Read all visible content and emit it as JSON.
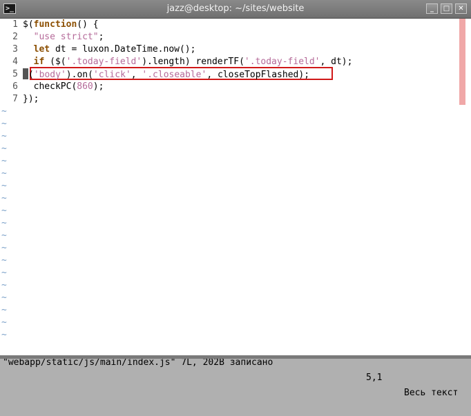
{
  "window": {
    "title": "jazz@desktop: ~/sites/website",
    "icon": "terminal-icon",
    "buttons": {
      "minimize": "_",
      "maximize": "□",
      "close": "✕"
    }
  },
  "editor": {
    "lines": [
      {
        "num": "1",
        "segments": [
          [
            "plain",
            "$("
          ],
          [
            "kw",
            "function"
          ],
          [
            "plain",
            "() {"
          ]
        ]
      },
      {
        "num": "2",
        "segments": [
          [
            "plain",
            "  "
          ],
          [
            "str",
            "\"use strict\""
          ],
          [
            "plain",
            ";"
          ]
        ]
      },
      {
        "num": "3",
        "segments": [
          [
            "plain",
            "  "
          ],
          [
            "kw",
            "let"
          ],
          [
            "plain",
            " dt = luxon.DateTime.now();"
          ]
        ]
      },
      {
        "num": "4",
        "segments": [
          [
            "plain",
            "  "
          ],
          [
            "kw",
            "if"
          ],
          [
            "plain",
            " ($("
          ],
          [
            "str",
            "'.today-field'"
          ],
          [
            "plain",
            ").length) renderTF("
          ],
          [
            "str",
            "'.today-field'"
          ],
          [
            "plain",
            ", dt);"
          ]
        ]
      },
      {
        "num": "5",
        "segments": [
          [
            "plain",
            "$("
          ],
          [
            "str",
            "'body'"
          ],
          [
            "plain",
            ").on("
          ],
          [
            "str",
            "'click'"
          ],
          [
            "plain",
            ", "
          ],
          [
            "str",
            "'.closeable'"
          ],
          [
            "plain",
            ", closeTopFlashed);"
          ]
        ]
      },
      {
        "num": "6",
        "segments": [
          [
            "plain",
            "  checkPC("
          ],
          [
            "num",
            "860"
          ],
          [
            "plain",
            ");"
          ]
        ]
      },
      {
        "num": "7",
        "segments": [
          [
            "plain",
            "});"
          ]
        ]
      }
    ],
    "tilde_char": "~",
    "tilde_count": 19,
    "cursor_line": 5
  },
  "status": {
    "file_info": "\"webapp/static/js/main/index.js\" 7L, 202B записано",
    "position": "5,1",
    "view": "Весь текст"
  },
  "colors": {
    "keyword": "#8b4e00",
    "string": "#b56a99",
    "tilde": "#7aa0c8",
    "highlight_box": "#d01818",
    "scroll_thumb": "#f0a8a8"
  }
}
